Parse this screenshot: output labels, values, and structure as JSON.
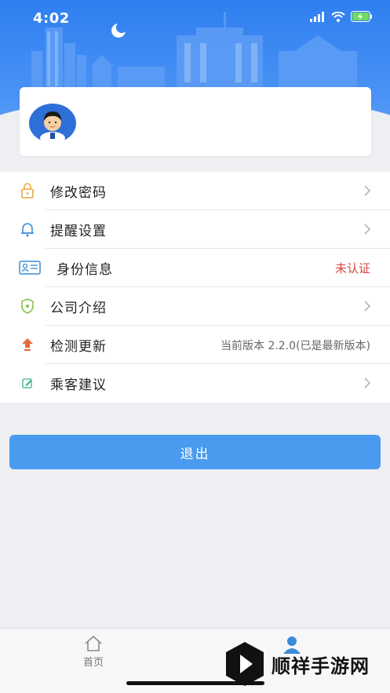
{
  "status_bar": {
    "time": "4:02"
  },
  "menu": {
    "items": [
      {
        "label": "修改密码",
        "value": "",
        "icon": "lock-icon"
      },
      {
        "label": "提醒设置",
        "value": "",
        "icon": "bell-icon"
      },
      {
        "label": "身份信息",
        "value": "未认证",
        "icon": "id-card-icon"
      },
      {
        "label": "公司介绍",
        "value": "",
        "icon": "shield-icon"
      },
      {
        "label": "检测更新",
        "value": "当前版本 2.2.0(已是最新版本)",
        "icon": "upgrade-icon"
      },
      {
        "label": "乘客建议",
        "value": "",
        "icon": "edit-icon"
      }
    ]
  },
  "logout_label": "退出",
  "tabbar": {
    "home_label": "首页",
    "profile_icon": "person-icon"
  },
  "watermark": {
    "text": "顺祥手游网"
  },
  "colors": {
    "primary": "#4a9bf0",
    "hero": "#2f7ff0",
    "alert": "#d9453b"
  }
}
